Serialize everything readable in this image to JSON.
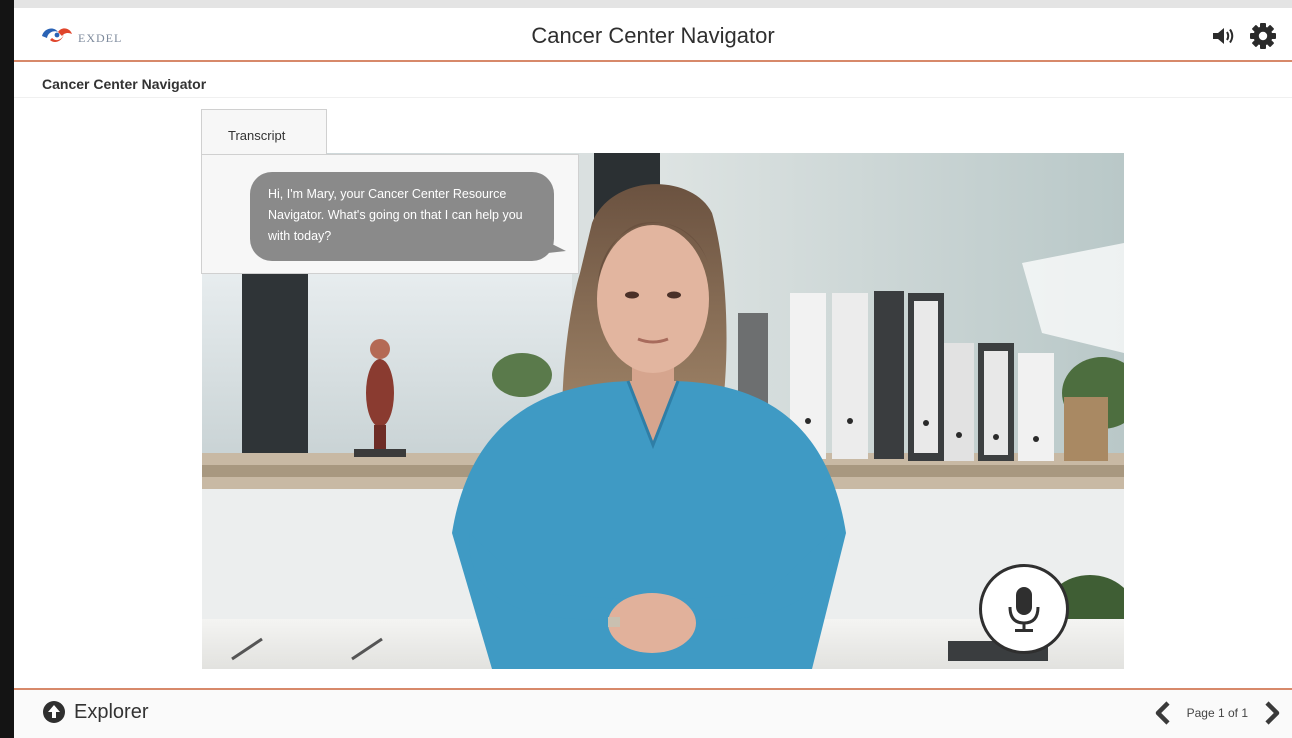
{
  "header": {
    "logo_text": "EXDEL",
    "title": "Cancer Center Navigator",
    "icons": {
      "sound": "speaker-icon",
      "settings": "gear-icon"
    }
  },
  "page": {
    "title": "Cancer Center Navigator"
  },
  "transcript": {
    "tab_label": "Transcript",
    "message": "Hi, I'm Mary, your Cancer Center Resource Navigator. What's going on that I can help you with today?"
  },
  "video": {
    "mic_icon": "microphone-icon"
  },
  "footer": {
    "explorer_label": "Explorer",
    "page_indicator": "Page 1 of 1",
    "icons": {
      "explorer": "up-arrow-circle-icon",
      "prev": "chevron-left-icon",
      "next": "chevron-right-icon"
    }
  },
  "colors": {
    "accent_rule": "#d7896a",
    "bubble": "#8a8a8a",
    "scrubs": "#3f9ac4"
  }
}
